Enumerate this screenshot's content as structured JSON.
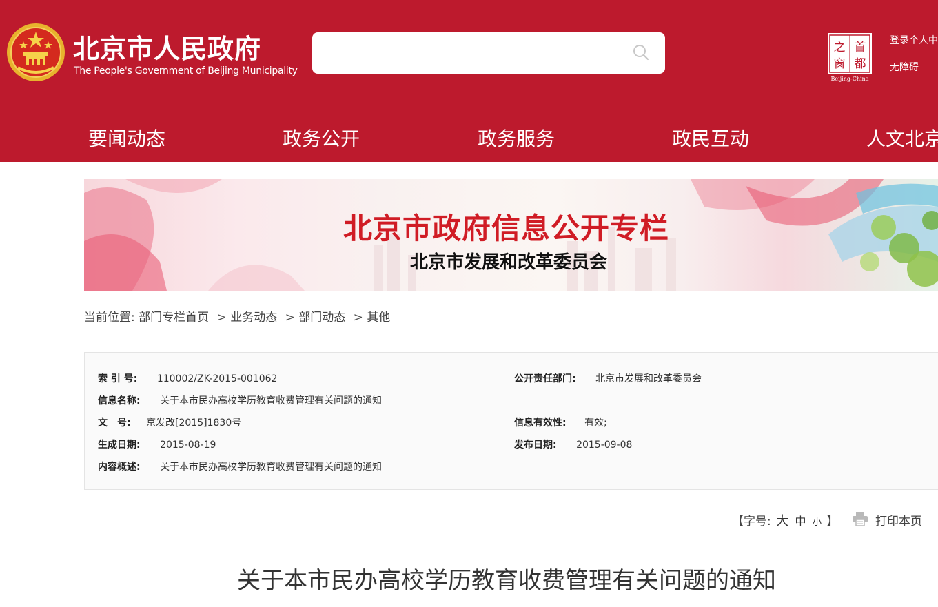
{
  "header": {
    "title_cn": "北京市人民政府",
    "title_en": "The People's Government of Beijing Municipality",
    "search": {
      "placeholder": "",
      "value": ""
    },
    "seal_text": [
      "之",
      "首",
      "窗",
      "都"
    ],
    "seal_caption": "Beijing-China",
    "links": {
      "login": "登录个人中",
      "accessibility": "无障碍"
    },
    "colors": {
      "brand_red": "#bd1a2d"
    }
  },
  "nav": {
    "items": [
      "要闻动态",
      "政务公开",
      "政务服务",
      "政民互动",
      "人文北京"
    ]
  },
  "banner": {
    "title": "北京市政府信息公开专栏",
    "subtitle": "北京市发展和改革委员会"
  },
  "breadcrumb": {
    "label": "当前位置:",
    "items": [
      "部门专栏首页",
      "业务动态",
      "部门动态",
      "其他"
    ],
    "separator": ">"
  },
  "info": {
    "index_no": {
      "key": "索 引 号:",
      "value": "110002/ZK-2015-001062"
    },
    "department": {
      "key": "公开责任部门:",
      "value": "北京市发展和改革委员会"
    },
    "name": {
      "key": "信息名称:",
      "value": "关于本市民办高校学历教育收费管理有关问题的通知"
    },
    "doc_no": {
      "key": "文　号:",
      "value": "京发改[2015]1830号"
    },
    "validity": {
      "key": "信息有效性:",
      "value": "有效;"
    },
    "created": {
      "key": "生成日期:",
      "value": "2015-08-19"
    },
    "published": {
      "key": "发布日期:",
      "value": "2015-09-08"
    },
    "summary": {
      "key": "内容概述:",
      "value": "关于本市民办高校学历教育收费管理有关问题的通知"
    }
  },
  "tools": {
    "font_open": "【字号:",
    "font_big": "大",
    "font_mid": "中",
    "font_small": "小",
    "font_close": "】",
    "print": "打印本页"
  },
  "article": {
    "title": "关于本市民办高校学历教育收费管理有关问题的通知"
  }
}
